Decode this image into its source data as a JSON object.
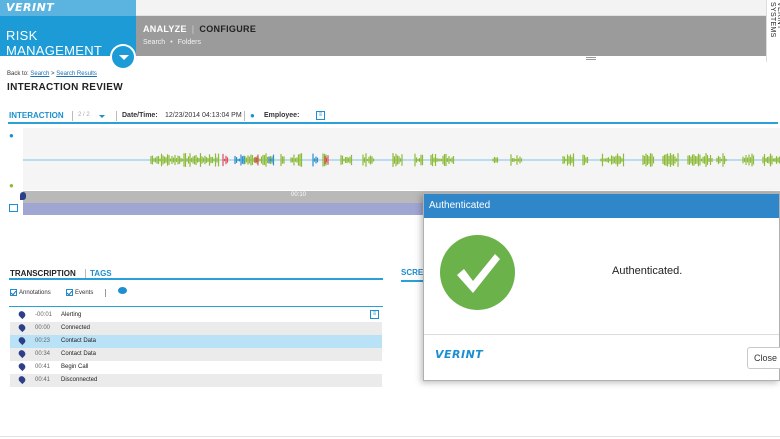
{
  "header": {
    "logo": "VERINT",
    "module": "RISK MANAGEMENT",
    "nav": {
      "analyze": "ANALYZE",
      "separator": "|",
      "configure": "CONFIGURE"
    },
    "subnav": {
      "search": "Search",
      "dot": "•",
      "folders": "Folders"
    },
    "side_brand": "VERINT SYSTEMS"
  },
  "breadcrumb": {
    "prefix": "Back to:",
    "search": "Search",
    "gt": ">",
    "results": "Search Results"
  },
  "page_title": "INTERACTION REVIEW",
  "interaction_bar": {
    "label": "INTERACTION",
    "pager": "2 / 2",
    "datetime_label": "Date/Time:",
    "datetime_value": "12/23/2014 04:13:04 PM",
    "employee_label": "Employee:"
  },
  "timeline": {
    "tick": "00:10"
  },
  "transcription": {
    "tab_transcription": "TRANSCRIPTION",
    "tab_tags": "TAGS",
    "filter_annotations": "Annotations",
    "filter_events": "Events",
    "events": [
      {
        "time": "-00:01",
        "label": "Alerting"
      },
      {
        "time": "00:00",
        "label": "Connected"
      },
      {
        "time": "00:23",
        "label": "Contact Data"
      },
      {
        "time": "00:34",
        "label": "Contact Data"
      },
      {
        "time": "00:41",
        "label": "Begin Call"
      },
      {
        "time": "00:41",
        "label": "Disconnected"
      }
    ]
  },
  "screen_tab": "SCRE",
  "modal": {
    "title": "Authenticated",
    "message": "Authenticated.",
    "footer_logo": "VERINT",
    "close_label": "Close"
  },
  "colors": {
    "accent": "#2aa0d8",
    "module_blue": "#1c9bd6",
    "nav_gray": "#9b9b9b",
    "success_green": "#6bb24a",
    "modal_header": "#2f86c9",
    "wave_green": "#8dbb38"
  }
}
